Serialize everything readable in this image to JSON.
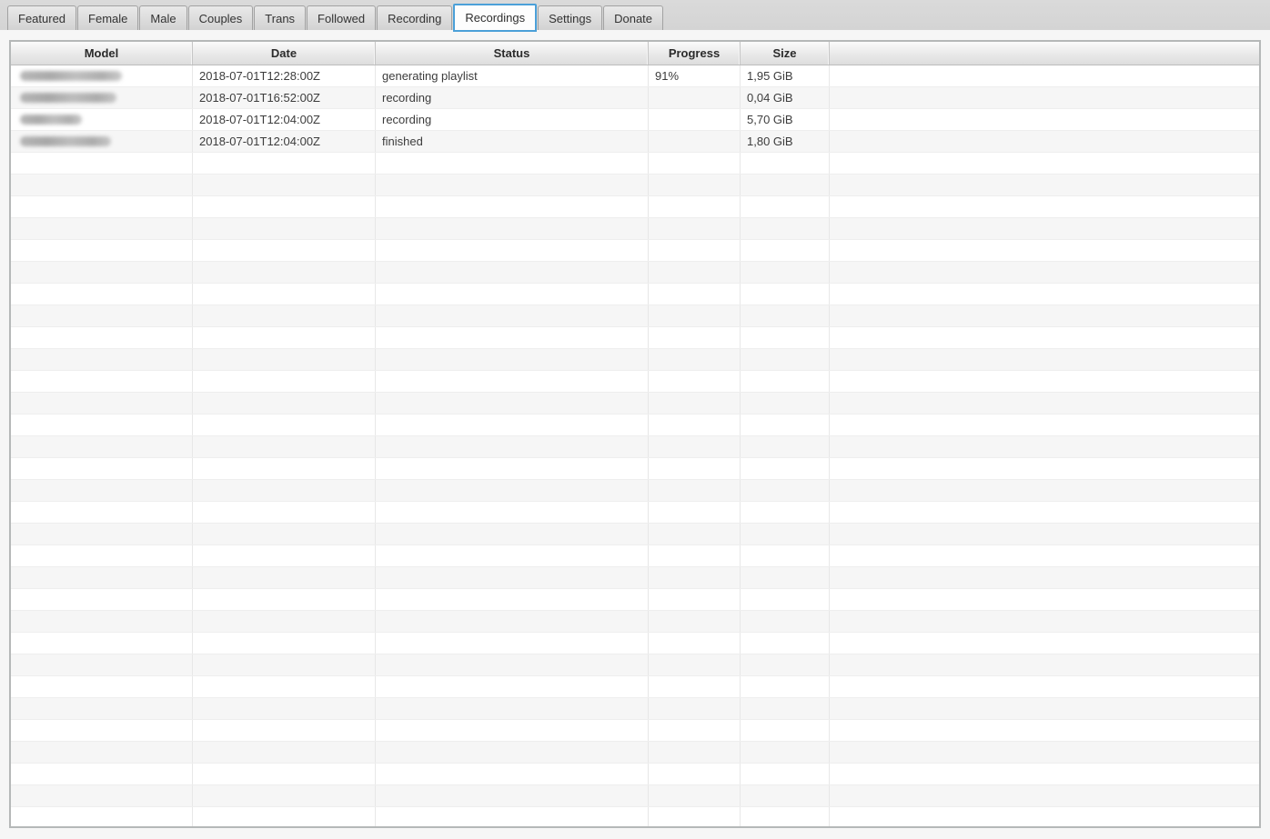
{
  "tab_bar": {
    "active_tab": "Recordings",
    "tabs": [
      {
        "label": "Featured",
        "active": false
      },
      {
        "label": "Female",
        "active": false
      },
      {
        "label": "Male",
        "active": false
      },
      {
        "label": "Couples",
        "active": false
      },
      {
        "label": "Trans",
        "active": false
      },
      {
        "label": "Followed",
        "active": false
      },
      {
        "label": "Recording",
        "active": false
      },
      {
        "label": "Recordings",
        "active": true
      },
      {
        "label": "Settings",
        "active": false
      },
      {
        "label": "Donate",
        "active": false
      }
    ]
  },
  "recordings_table": {
    "columns": [
      "Model",
      "Date",
      "Status",
      "Progress",
      "Size",
      ""
    ],
    "rows": [
      {
        "model_censored": true,
        "model_blur_width": 112,
        "date": "2018-07-01T12:28:00Z",
        "status": "generating playlist",
        "progress": "91%",
        "size": "1,95 GiB"
      },
      {
        "model_censored": true,
        "model_blur_width": 106,
        "date": "2018-07-01T16:52:00Z",
        "status": "recording",
        "progress": "",
        "size": "0,04 GiB"
      },
      {
        "model_censored": true,
        "model_blur_width": 68,
        "date": "2018-07-01T12:04:00Z",
        "status": "recording",
        "progress": "",
        "size": "5,70 GiB"
      },
      {
        "model_censored": true,
        "model_blur_width": 100,
        "date": "2018-07-01T12:04:00Z",
        "status": "finished",
        "progress": "",
        "size": "1,80 GiB"
      }
    ],
    "empty_row_count": 31
  },
  "colors": {
    "active_tab_border": "#4ba0d8",
    "tab_strip_bg": "#d6d6d6",
    "row_stripe": "#f6f6f6",
    "table_border": "#b5b8b8",
    "header_text": "#2b2b2b",
    "cell_text": "#3c3c3c"
  }
}
